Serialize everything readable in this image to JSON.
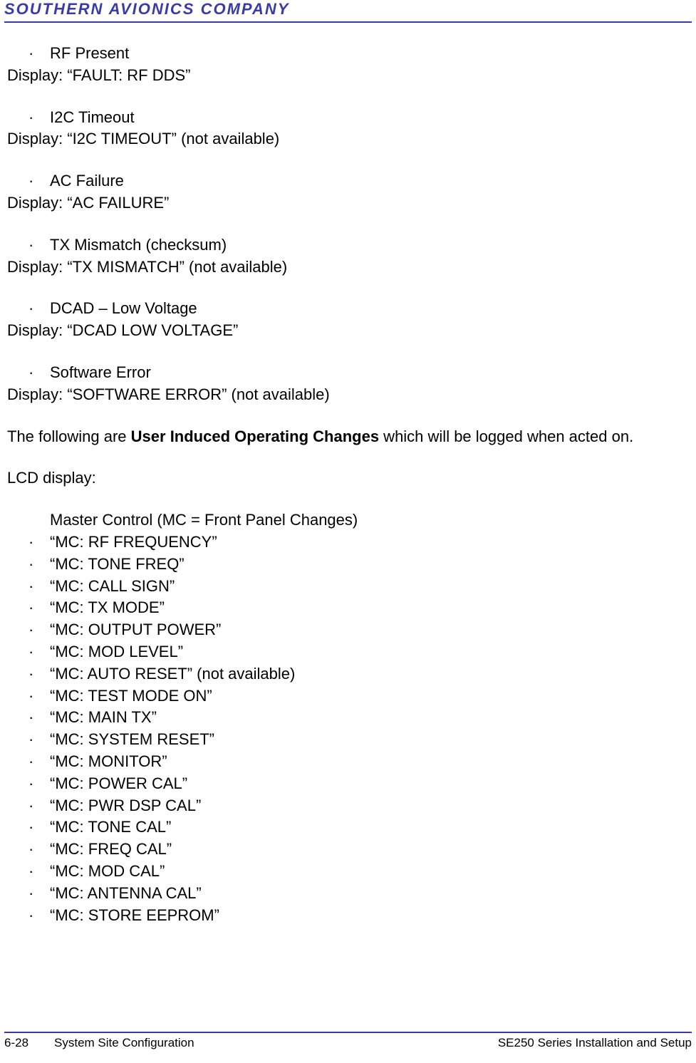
{
  "header": {
    "company": "SOUTHERN AVIONICS COMPANY"
  },
  "faults": [
    {
      "name": "RF Present",
      "display": "Display: “FAULT: RF DDS”"
    },
    {
      "name": "I2C Timeout",
      "display": "Display: “I2C TIMEOUT” (not available)"
    },
    {
      "name": "AC Failure",
      "display": "Display: “AC FAILURE”"
    },
    {
      "name": "TX Mismatch (checksum)",
      "display": "Display: “TX MISMATCH” (not available)"
    },
    {
      "name": "DCAD – Low Voltage",
      "display": "Display: “DCAD LOW VOLTAGE”"
    },
    {
      "name": "Software Error",
      "display": "Display: “SOFTWARE ERROR” (not available)"
    }
  ],
  "intro": {
    "before": "The following are ",
    "bold": "User Induced Operating Changes",
    "after": " which will be logged when acted on."
  },
  "lcd_label": "LCD display:",
  "mc_heading": "Master Control (MC = Front Panel Changes)",
  "mc_items": [
    "“MC: RF FREQUENCY”",
    "“MC: TONE FREQ”",
    "“MC: CALL SIGN”",
    "“MC: TX MODE”",
    "“MC: OUTPUT POWER”",
    "“MC: MOD LEVEL”",
    "“MC: AUTO RESET” (not available)",
    "“MC: TEST MODE ON”",
    "“MC: MAIN TX”",
    "“MC: SYSTEM RESET”",
    "“MC: MONITOR”",
    "“MC: POWER CAL”",
    "“MC: PWR DSP CAL”",
    "“MC: TONE CAL”",
    "“MC: FREQ CAL”",
    "“MC: MOD CAL”",
    "“MC: ANTENNA CAL”",
    "“MC: STORE EEPROM”"
  ],
  "footer": {
    "page": "6-28",
    "section": "System Site Configuration",
    "doc": "SE250 Series Installation and Setup"
  }
}
